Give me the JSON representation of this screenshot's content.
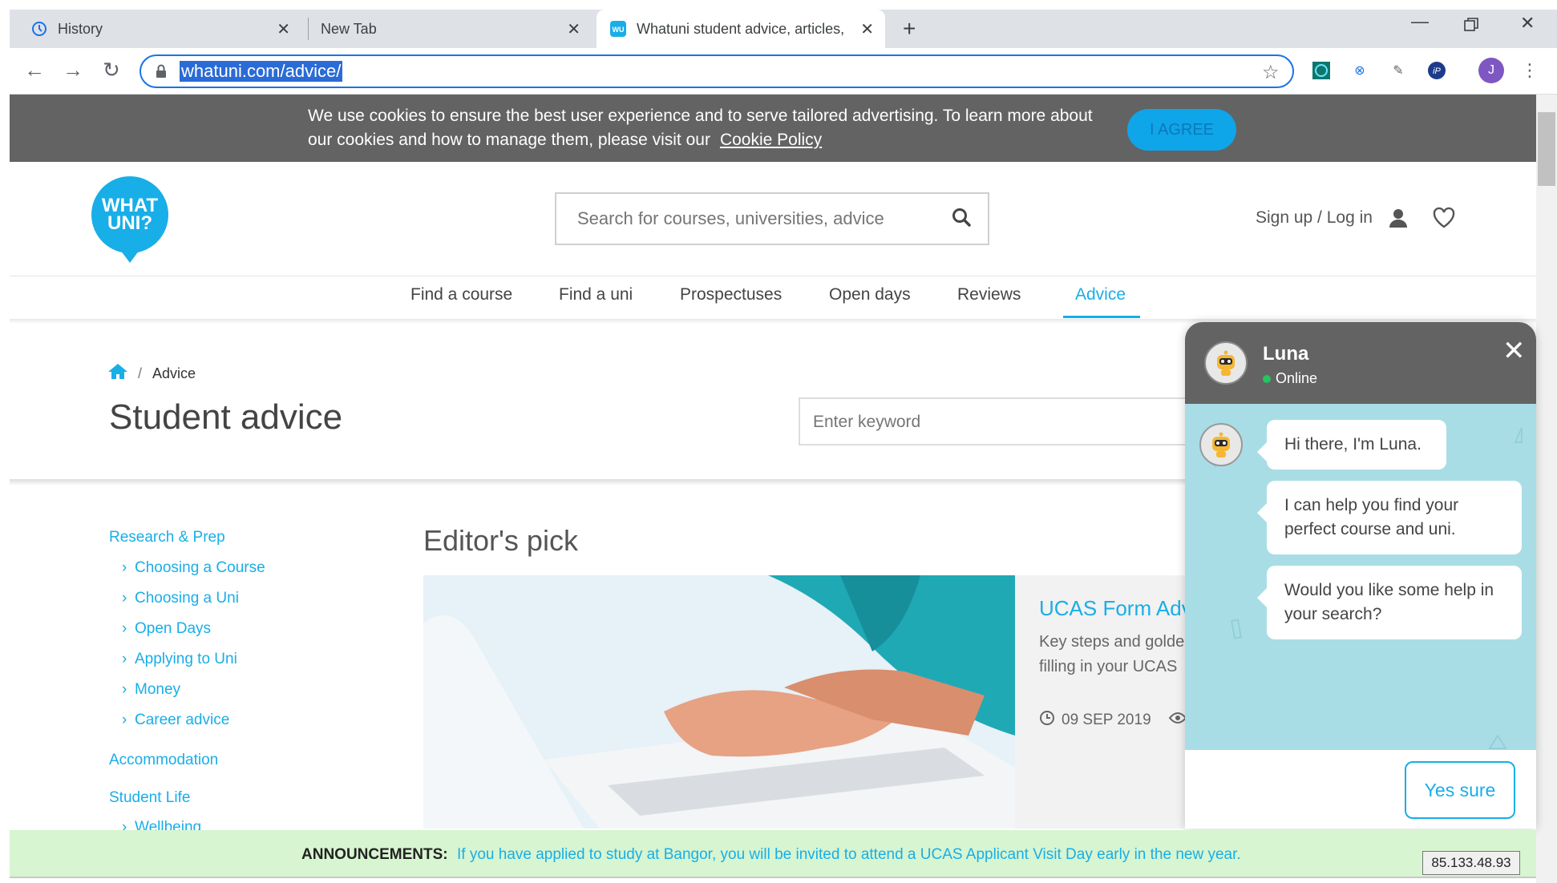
{
  "browser": {
    "tabs": [
      {
        "label": "History"
      },
      {
        "label": "New Tab"
      },
      {
        "label": "Whatuni student advice, articles,"
      }
    ],
    "url": "whatuni.com/advice/",
    "profile_initial": "J"
  },
  "cookie": {
    "text_line1": "We use cookies to ensure the best user experience and to serve tailored advertising. To learn more about",
    "text_line2": "our cookies and how to manage them, please visit our",
    "link": "Cookie Policy",
    "agree": "I AGREE"
  },
  "header": {
    "logo_line1": "WHAT",
    "logo_line2": "UNI?",
    "search_placeholder": "Search for courses, universities, advice",
    "signup": "Sign up / Log in"
  },
  "nav": {
    "items": [
      "Find a course",
      "Find a uni",
      "Prospectuses",
      "Open days",
      "Reviews",
      "Advice"
    ],
    "active": "Advice"
  },
  "breadcrumb": {
    "current": "Advice"
  },
  "page": {
    "title": "Student advice",
    "keyword_placeholder": "Enter keyword"
  },
  "sidebar": {
    "research_head": "Research & Prep",
    "research_items": [
      "Choosing a Course",
      "Choosing a Uni",
      "Open Days",
      "Applying to Uni",
      "Money",
      "Career advice"
    ],
    "accommodation": "Accommodation",
    "student_life": "Student Life",
    "wellbeing": "Wellbeing"
  },
  "editors_pick": {
    "heading": "Editor's pick",
    "title": "UCAS Form Adv",
    "desc_line1": "Key steps and golde",
    "desc_line2": "filling in your UCAS",
    "date": "09 SEP 2019"
  },
  "chat": {
    "name": "Luna",
    "status": "Online",
    "messages": [
      "Hi there, I'm Luna.",
      "I can help you find your perfect course and uni.",
      "Would you like some help in your search?"
    ],
    "reply_button": "Yes sure"
  },
  "announcement": {
    "label": "ANNOUNCEMENTS:",
    "text": "If you have applied to study at Bangor, you will be invited to attend a UCAS Applicant Visit Day early in the new year."
  },
  "ip_address": "85.133.48.93",
  "colors": {
    "brand": "#18aee8",
    "cookie_bg": "#636363",
    "announce_bg": "#d7f5d0",
    "chat_body": "#a9dde6"
  }
}
